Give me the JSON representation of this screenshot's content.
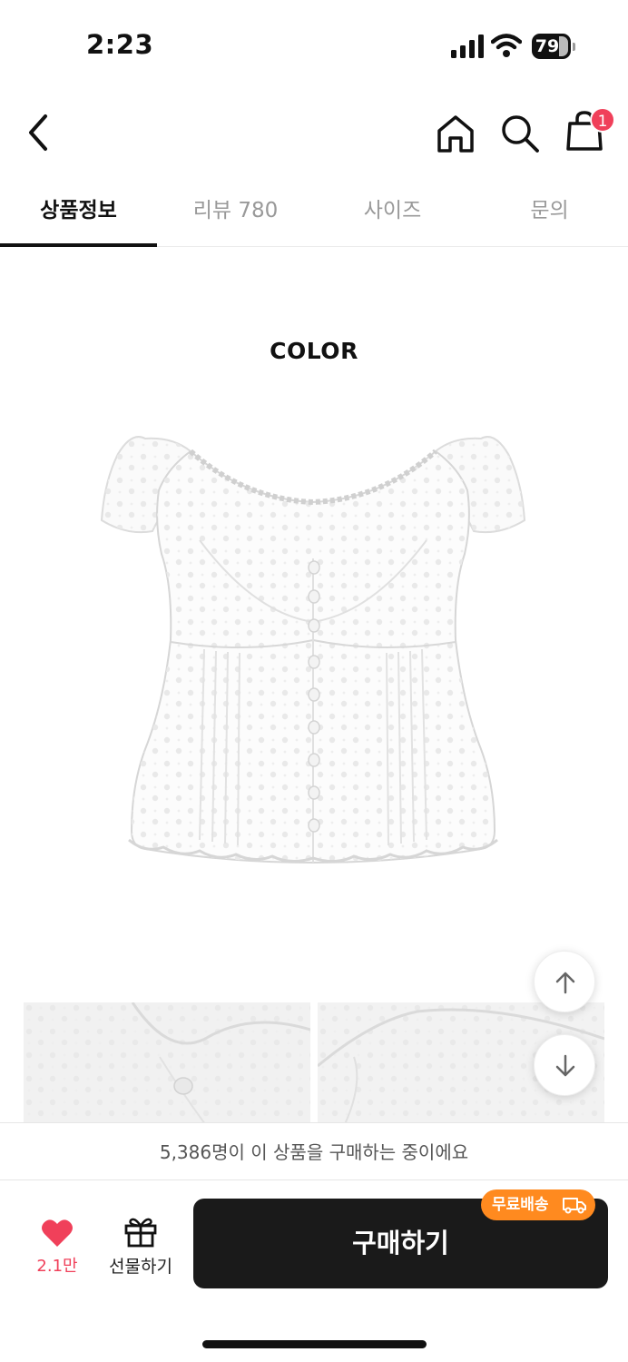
{
  "status_bar": {
    "time": "2:23",
    "battery": "79"
  },
  "header": {
    "cart_count": "1"
  },
  "tabs": [
    {
      "label": "상품정보"
    },
    {
      "label": "리뷰 780"
    },
    {
      "label": "사이즈"
    },
    {
      "label": "문의"
    }
  ],
  "content": {
    "section_title": "COLOR"
  },
  "notice": {
    "text": "5,386명이 이 상품을 구매하는 중이에요"
  },
  "bottom_bar": {
    "like_count": "2.1만",
    "gift_label": "선물하기",
    "buy_label": "구매하기",
    "free_shipping_label": "무료배송"
  },
  "colors": {
    "accent": "#f0405a",
    "buy_button": "#1a1a1a",
    "free_shipping": "#ff8a1f"
  }
}
